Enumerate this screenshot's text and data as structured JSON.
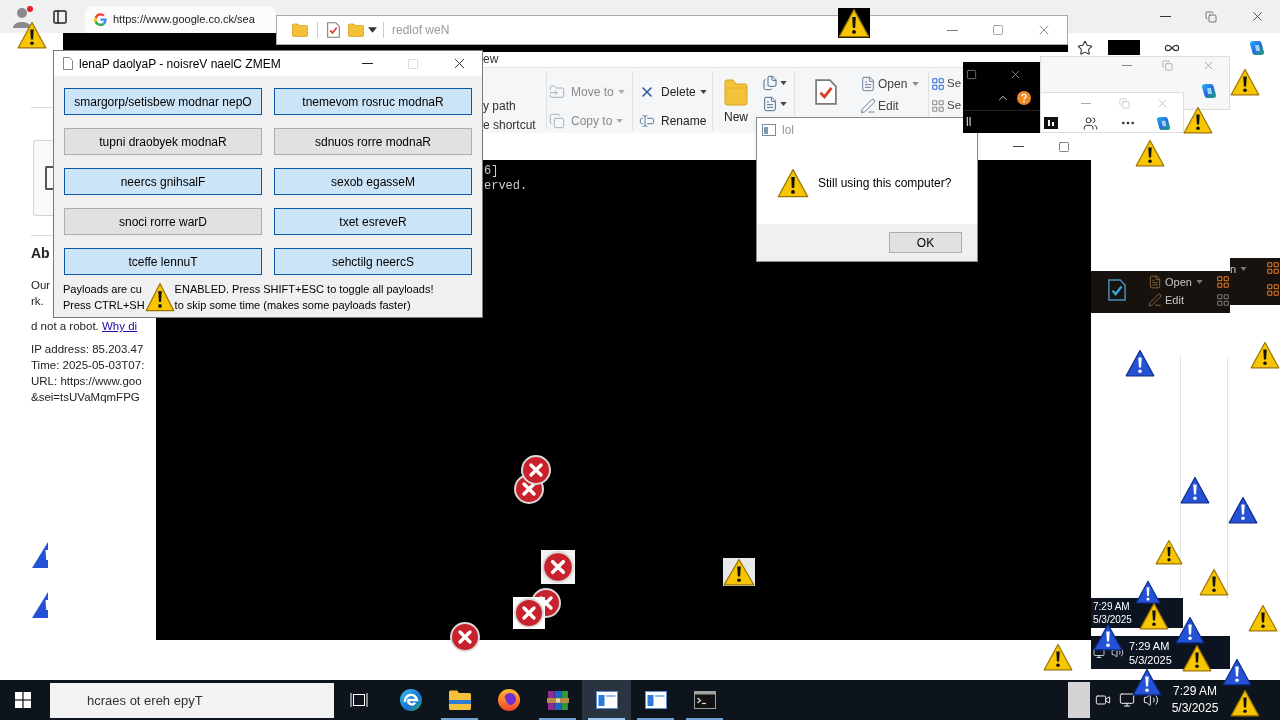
{
  "browser": {
    "tab_title": "https://www.google.co.ck/sea",
    "page": {
      "captcha": {
        "checked": false
      },
      "heading": "Ab",
      "notice_lines": [
        {
          "text": "Our"
        },
        {
          "text": "rk."
        },
        {
          "text": "d not a robot.",
          "link": "Why di"
        }
      ],
      "detail_lines": [
        "IP address: 85.203.47",
        "Time: 2025-05-03T07:",
        "URL: https://www.goo",
        "&sei=tsUVaMqmFPG"
      ]
    }
  },
  "explorer": {
    "title": "redlof weN",
    "tab_fragment": "ew",
    "clipboard_fragment": [
      "y path",
      "e shortcut"
    ],
    "organize": [
      {
        "label": "Move to",
        "dropdown": true,
        "disabled": true
      },
      {
        "label": "Copy to",
        "dropdown": true,
        "disabled": true
      },
      {
        "label": "Delete",
        "dropdown": true,
        "disabled": false
      },
      {
        "label": "Rename",
        "dropdown": false,
        "disabled": false
      }
    ],
    "new_label": "New",
    "open": [
      {
        "label": "Open",
        "dropdown": true
      },
      {
        "label": "Edit",
        "dropdown": false
      }
    ],
    "select": [
      "Se",
      "Se"
    ]
  },
  "console": {
    "lines": [
      "6]",
      "erved."
    ]
  },
  "payload_panel": {
    "title": "lenaP daolyaP - noisreV naelC ZMEM",
    "payloads": [
      {
        "label": "smargorp/setisbew modnar nepO",
        "on": true
      },
      {
        "label": "tnemevom rosruc modnaR",
        "on": true
      },
      {
        "label": "tupni draobyek modnaR",
        "on": false
      },
      {
        "label": "sdnuos rorre modnaR",
        "on": false
      },
      {
        "label": "neercs gnihsalF",
        "on": true
      },
      {
        "label": "sexob egasseM",
        "on": true
      },
      {
        "label": "snoci rorre warD",
        "on": false
      },
      {
        "label": "txet esreveR",
        "on": true
      },
      {
        "label": "tceffe lennuT",
        "on": true
      },
      {
        "label": "sehctilg neercS",
        "on": true
      }
    ],
    "status_lines": [
      {
        "before": "Payloads are cu",
        "after": "ENABLED. Press SHIFT+ESC to toggle all payloads!"
      },
      {
        "before": "Press CTRL+SH",
        "after": "to skip some time (makes some payloads faster)"
      }
    ]
  },
  "message_box": {
    "title": "lol",
    "message": "Still using this computer?",
    "button": "OK"
  },
  "dark_window": {
    "text": "ll"
  },
  "ribbon_fragment": {
    "open": [
      {
        "label": "Open",
        "dropdown": true
      },
      {
        "label": "Edit",
        "dropdown": false
      }
    ],
    "side": {
      "label": "n",
      "dropdown": true
    }
  },
  "clock_fragments": [
    {
      "time": "7:29 AM",
      "date": "5/3/2025"
    },
    {
      "time": "7:29 AM",
      "date": "5/3/2025"
    }
  ],
  "taskbar": {
    "search": {
      "placeholder": "hcraes ot ereh epyT"
    },
    "apps": [
      {
        "kind": "edge",
        "open": false,
        "selected": false
      },
      {
        "kind": "files",
        "open": true,
        "selected": false
      },
      {
        "kind": "firefox",
        "open": false,
        "selected": false
      },
      {
        "kind": "archive",
        "open": true,
        "selected": false
      },
      {
        "kind": "window",
        "open": true,
        "selected": true
      },
      {
        "kind": "window",
        "open": true,
        "selected": false
      },
      {
        "kind": "terminal",
        "open": true,
        "selected": false
      }
    ],
    "time": "7:29 AM",
    "date": "5/3/2025"
  }
}
